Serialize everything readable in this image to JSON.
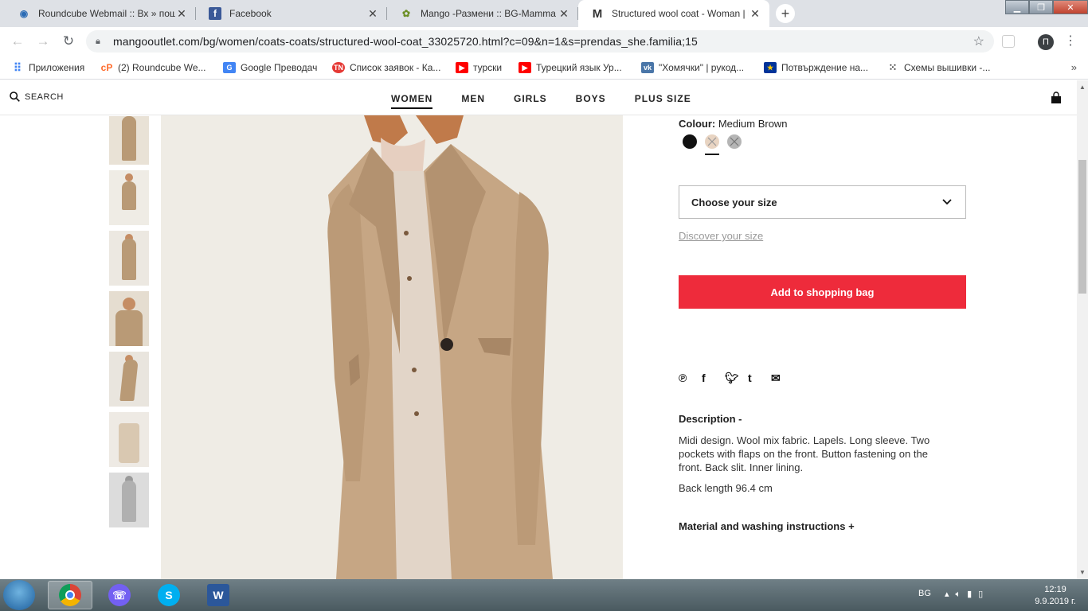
{
  "browser": {
    "tabs": [
      {
        "title": "Roundcube Webmail :: Вх » пощ",
        "close": "✕",
        "icon": "roundcube-icon",
        "color": "#2a6bb5"
      },
      {
        "title": "Facebook",
        "close": "✕",
        "icon": "facebook-icon",
        "color": "#3b5998"
      },
      {
        "title": "Mango -Размени :: BG-Mamma",
        "close": "✕",
        "icon": "bgmamma-icon",
        "color": "#6b8e23"
      },
      {
        "title": "Structured wool coat - Woman | M",
        "close": "✕",
        "icon": "mango-icon",
        "color": "#111111"
      }
    ],
    "url": "mangooutlet.com/bg/women/coats-coats/structured-wool-coat_33025720.html?c=09&n=1&s=prendas_she.familia;15",
    "profile_initial": "П",
    "bookmarks": [
      {
        "label": "Приложения",
        "icon": "apps-grid-icon",
        "color": "#4285f4"
      },
      {
        "label": "(2) Roundcube We...",
        "icon": "cpanel-icon",
        "color": "#ff6c2c"
      },
      {
        "label": "Google Преводач",
        "icon": "google-translate-icon",
        "color": "#4285f4"
      },
      {
        "label": "Список заявок - Ка...",
        "icon": "tn-icon",
        "color": "#e53935"
      },
      {
        "label": "турски",
        "icon": "youtube-icon",
        "color": "#ff0000"
      },
      {
        "label": "Турецкий язык Ур...",
        "icon": "youtube-icon",
        "color": "#ff0000"
      },
      {
        "label": "\"Хомячки\" | рукод...",
        "icon": "vk-icon",
        "color": "#4a76a8"
      },
      {
        "label": "Потвърждение на...",
        "icon": "eu-flag-icon",
        "color": "#003399"
      },
      {
        "label": "Схемы вышивки -...",
        "icon": "embroidery-icon",
        "color": "#333333"
      }
    ],
    "more": "»"
  },
  "header": {
    "search_label": "SEARCH",
    "nav": [
      "WOMEN",
      "MEN",
      "GIRLS",
      "BOYS",
      "PLUS SIZE"
    ],
    "active_nav": "WOMEN"
  },
  "product": {
    "colour_label": "Colour:",
    "colour_value": "Medium Brown",
    "swatches": [
      {
        "name": "black",
        "color": "#111111"
      },
      {
        "name": "medium-brown",
        "color": "#e8d4c2"
      },
      {
        "name": "grey",
        "color": "#b5b5b5"
      }
    ],
    "size_placeholder": "Choose your size",
    "discover_size": "Discover your size",
    "add_to_bag": "Add to shopping bag",
    "description_title": "Description -",
    "description": "Midi design. Wool mix fabric. Lapels. Long sleeve. Two pockets with flaps on the front. Button fastening on the front. Back slit. Inner lining.",
    "back_length": "Back length 96.4 cm",
    "material_title": "Material and washing instructions +"
  },
  "taskbar": {
    "lang": "BG",
    "time": "12:19",
    "date": "9.9.2019 г."
  }
}
